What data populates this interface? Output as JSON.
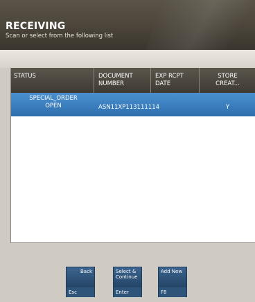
{
  "header": {
    "title": "RECEIVING",
    "subtitle": "Scan or select from the following list"
  },
  "grid": {
    "columns": [
      {
        "line1": "STATUS",
        "line2": ""
      },
      {
        "line1": "DOCUMENT",
        "line2": "NUMBER"
      },
      {
        "line1": "EXP RCPT",
        "line2": "DATE"
      },
      {
        "line1": "STORE",
        "line2": "CREAT..."
      }
    ],
    "rows": [
      {
        "status_line1": "SPECIAL_ORDER",
        "status_line2": "OPEN",
        "document_number": "ASN11XP113111114",
        "exp_rcpt_date": "",
        "store_created": "Y"
      }
    ]
  },
  "buttons": {
    "back": {
      "label": "Back",
      "key": "Esc"
    },
    "select": {
      "label_line1": "Select &",
      "label_line2": "Continue",
      "key": "Enter"
    },
    "add_new": {
      "label": "Add New",
      "key": "F8"
    }
  },
  "colors": {
    "header_bg": "#4a443a",
    "selected_row": "#3a7fc0",
    "button_bg": "#294a6c"
  }
}
